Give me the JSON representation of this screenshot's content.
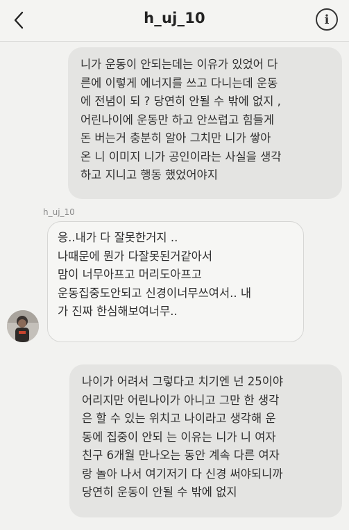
{
  "header": {
    "title": "h_uj_10",
    "back_icon": "chevron-left-icon",
    "info_icon": "info-circle-icon",
    "info_glyph": "i"
  },
  "messages": [
    {
      "direction": "outgoing",
      "text": "니가 운동이 안되는데는 이유가 있었어  다\n른에 이렇게 에너지를 쓰고 다니는데 운동\n에 전념이 되 ? 당연히 안될 수 밖에 없지  ,\n어린나이에 운동만 하고 안쓰럽고 힘들게\n돈 버는거  충분히 알아 그치만 니가 쌓아\n온 니 이미지 니가 공인이라는 사실을 생각\n하고 지니고 행동 했었어야지"
    },
    {
      "direction": "incoming",
      "sender": "h_uj_10",
      "text": "응..내가 다 잘못한거지 ..\n나때문에 뭔가 다잘못된거같아서\n맘이 너무아프고 머리도아프고\n운동집중도안되고 신경이너무쓰여서.. 내\n가 진짜 한심해보여너무.."
    },
    {
      "direction": "outgoing",
      "text": "나이가 어려서 그렇다고 치기엔 넌 25이야\n어리지만 어린나이가 아니고 그만 한 생각\n은 할 수 있는 위치고 나이라고 생각해 운\n동에 집중이 안되 는 이유는 니가 니 여자\n친구 6개월 만나오는 동안 계속 다른 여자\n랑 놀아 나서 여기저기 다 신경 써야되니까\n당연히 운동이 안될 수 밖에 없지"
    }
  ]
}
